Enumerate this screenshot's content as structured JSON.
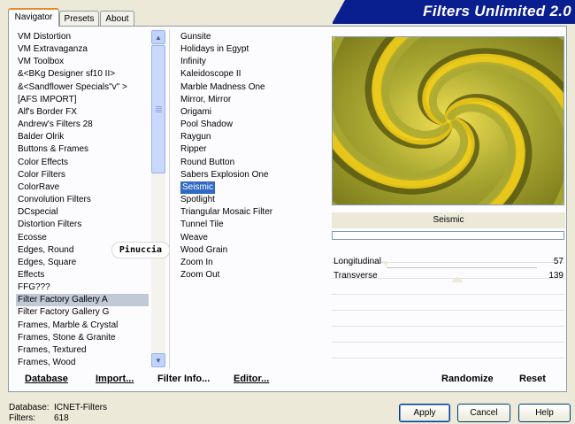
{
  "tabs": [
    {
      "label": "Navigator",
      "active": true
    },
    {
      "label": "Presets",
      "active": false
    },
    {
      "label": "About",
      "active": false
    }
  ],
  "banner_title": "Filters Unlimited 2.0",
  "categories": [
    "VM Distortion",
    "VM Extravaganza",
    "VM Toolbox",
    "&<BKg Designer sf10 II>",
    "&<Sandflower Specials\"v\" >",
    "[AFS IMPORT]",
    "Alf's Border FX",
    "Andrew's Filters 28",
    "Balder Olrik",
    "Buttons & Frames",
    "Color Effects",
    "Color Filters",
    "ColorRave",
    "Convolution Filters",
    "DCspecial",
    "Distortion Filters",
    "Ecosse",
    "Edges, Round",
    "Edges, Square",
    "Effects",
    "FFG???",
    "Filter Factory Gallery A",
    "Filter Factory Gallery G",
    "Frames, Marble & Crystal",
    "Frames, Stone & Granite",
    "Frames, Textured",
    "Frames, Wood"
  ],
  "highlighted_category": "Filter Factory Gallery A",
  "filters": [
    "Gunsite",
    "Holidays in Egypt",
    "Infinity",
    "Kaleidoscope II",
    "Marble Madness One",
    "Mirror, Mirror",
    "Origami",
    "Pool Shadow",
    "Raygun",
    "Ripper",
    "Round Button",
    "Sabers Explosion One",
    "Seismic",
    "Spotlight",
    "Triangular Mosaic Filter",
    "Tunnel Tile",
    "Weave",
    "Wood Grain",
    "Zoom In",
    "Zoom Out"
  ],
  "selected_filter": "Seismic",
  "watermark": "Pinuccia",
  "preview": {
    "filter_name": "Seismic",
    "colors": {
      "dark": "#5a5a12",
      "mid": "#a9a832",
      "bright": "#f5cf18"
    }
  },
  "params": [
    {
      "label": "Longitudinal",
      "value": "57"
    },
    {
      "label": "Transverse",
      "value": "139"
    }
  ],
  "links": {
    "database": "Database",
    "import": "Import...",
    "filter_info": "Filter Info...",
    "editor": "Editor...",
    "randomize": "Randomize",
    "reset": "Reset"
  },
  "status": {
    "database_label": "Database:",
    "database_value": "ICNET-Filters",
    "filters_label": "Filters:",
    "filters_value": "618"
  },
  "buttons": {
    "apply": "Apply",
    "cancel": "Cancel",
    "help": "Help"
  },
  "colors": {
    "selection": "#316ac5",
    "banner": "#0a1f8f",
    "tab_accent": "#e68b2c"
  }
}
